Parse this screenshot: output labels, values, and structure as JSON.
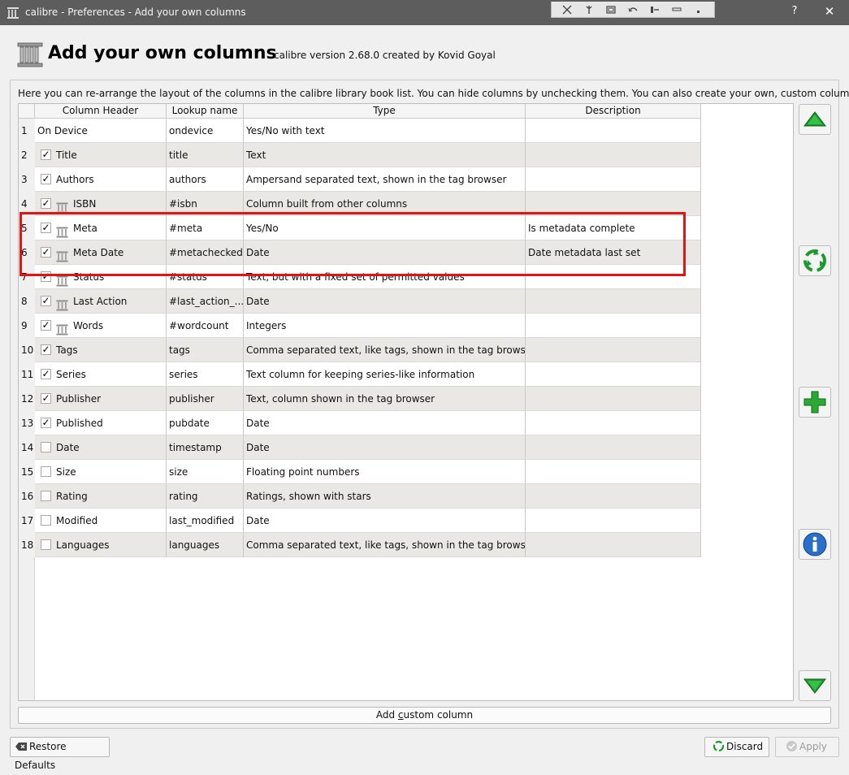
{
  "window": {
    "title": "calibre - Preferences - Add your own columns",
    "help_label": "?",
    "close_label": "✕"
  },
  "header": {
    "title": "Add your own columns",
    "version": "calibre version 2.68.0 created by Kovid Goyal"
  },
  "intro": "Here you can re-arrange the layout of the columns in the calibre library book list. You can hide columns by unchecking them. You can also create your own, custom columns.",
  "table": {
    "headers": [
      "Column Header",
      "Lookup name",
      "Type",
      "Description"
    ],
    "rows": [
      {
        "num": "1",
        "checkbox": false,
        "checked": false,
        "custom": false,
        "header": "On Device",
        "lookup": "ondevice",
        "type": "Yes/No with text",
        "description": ""
      },
      {
        "num": "2",
        "checkbox": true,
        "checked": true,
        "custom": false,
        "header": "Title",
        "lookup": "title",
        "type": "Text",
        "description": ""
      },
      {
        "num": "3",
        "checkbox": true,
        "checked": true,
        "custom": false,
        "header": "Authors",
        "lookup": "authors",
        "type": "Ampersand separated text, shown in the tag browser",
        "description": ""
      },
      {
        "num": "4",
        "checkbox": true,
        "checked": true,
        "custom": true,
        "header": "ISBN",
        "lookup": "#isbn",
        "type": "Column built from other columns",
        "description": ""
      },
      {
        "num": "5",
        "checkbox": true,
        "checked": true,
        "custom": true,
        "header": "Meta",
        "lookup": "#meta",
        "type": "Yes/No",
        "description": "Is metadata complete"
      },
      {
        "num": "6",
        "checkbox": true,
        "checked": true,
        "custom": true,
        "header": "Meta Date",
        "lookup": "#metachecked",
        "type": "Date",
        "description": "Date metadata last set"
      },
      {
        "num": "7",
        "checkbox": true,
        "checked": true,
        "custom": true,
        "header": "Status",
        "lookup": "#status",
        "type": "Text, but with a fixed set of permitted values",
        "description": ""
      },
      {
        "num": "8",
        "checkbox": true,
        "checked": true,
        "custom": true,
        "header": "Last Action",
        "lookup": "#last_action_...",
        "type": "Date",
        "description": ""
      },
      {
        "num": "9",
        "checkbox": true,
        "checked": true,
        "custom": true,
        "header": "Words",
        "lookup": "#wordcount",
        "type": "Integers",
        "description": ""
      },
      {
        "num": "10",
        "checkbox": true,
        "checked": true,
        "custom": false,
        "header": "Tags",
        "lookup": "tags",
        "type": "Comma separated text, like tags, shown in the tag browser",
        "description": ""
      },
      {
        "num": "11",
        "checkbox": true,
        "checked": true,
        "custom": false,
        "header": "Series",
        "lookup": "series",
        "type": "Text column for keeping series-like information",
        "description": ""
      },
      {
        "num": "12",
        "checkbox": true,
        "checked": true,
        "custom": false,
        "header": "Publisher",
        "lookup": "publisher",
        "type": "Text, column shown in the tag browser",
        "description": ""
      },
      {
        "num": "13",
        "checkbox": true,
        "checked": true,
        "custom": false,
        "header": "Published",
        "lookup": "pubdate",
        "type": "Date",
        "description": ""
      },
      {
        "num": "14",
        "checkbox": true,
        "checked": false,
        "custom": false,
        "header": "Date",
        "lookup": "timestamp",
        "type": "Date",
        "description": ""
      },
      {
        "num": "15",
        "checkbox": true,
        "checked": false,
        "custom": false,
        "header": "Size",
        "lookup": "size",
        "type": "Floating point numbers",
        "description": ""
      },
      {
        "num": "16",
        "checkbox": true,
        "checked": false,
        "custom": false,
        "header": "Rating",
        "lookup": "rating",
        "type": "Ratings, shown with stars",
        "description": ""
      },
      {
        "num": "17",
        "checkbox": true,
        "checked": false,
        "custom": false,
        "header": "Modified",
        "lookup": "last_modified",
        "type": "Date",
        "description": ""
      },
      {
        "num": "18",
        "checkbox": true,
        "checked": false,
        "custom": false,
        "header": "Languages",
        "lookup": "languages",
        "type": "Comma separated text, like tags, shown in the tag browser",
        "description": ""
      }
    ]
  },
  "buttons": {
    "add_custom_column_prefix": "Add ",
    "add_custom_column_mnemonic": "c",
    "add_custom_column_suffix": "ustom column",
    "restore_defaults": "Restore Defaults",
    "discard": "Discard",
    "apply": "Apply"
  },
  "colors": {
    "highlight": "#e01414",
    "titlebar": "#5d5d5d",
    "alt_row": "#e9e8e4"
  }
}
